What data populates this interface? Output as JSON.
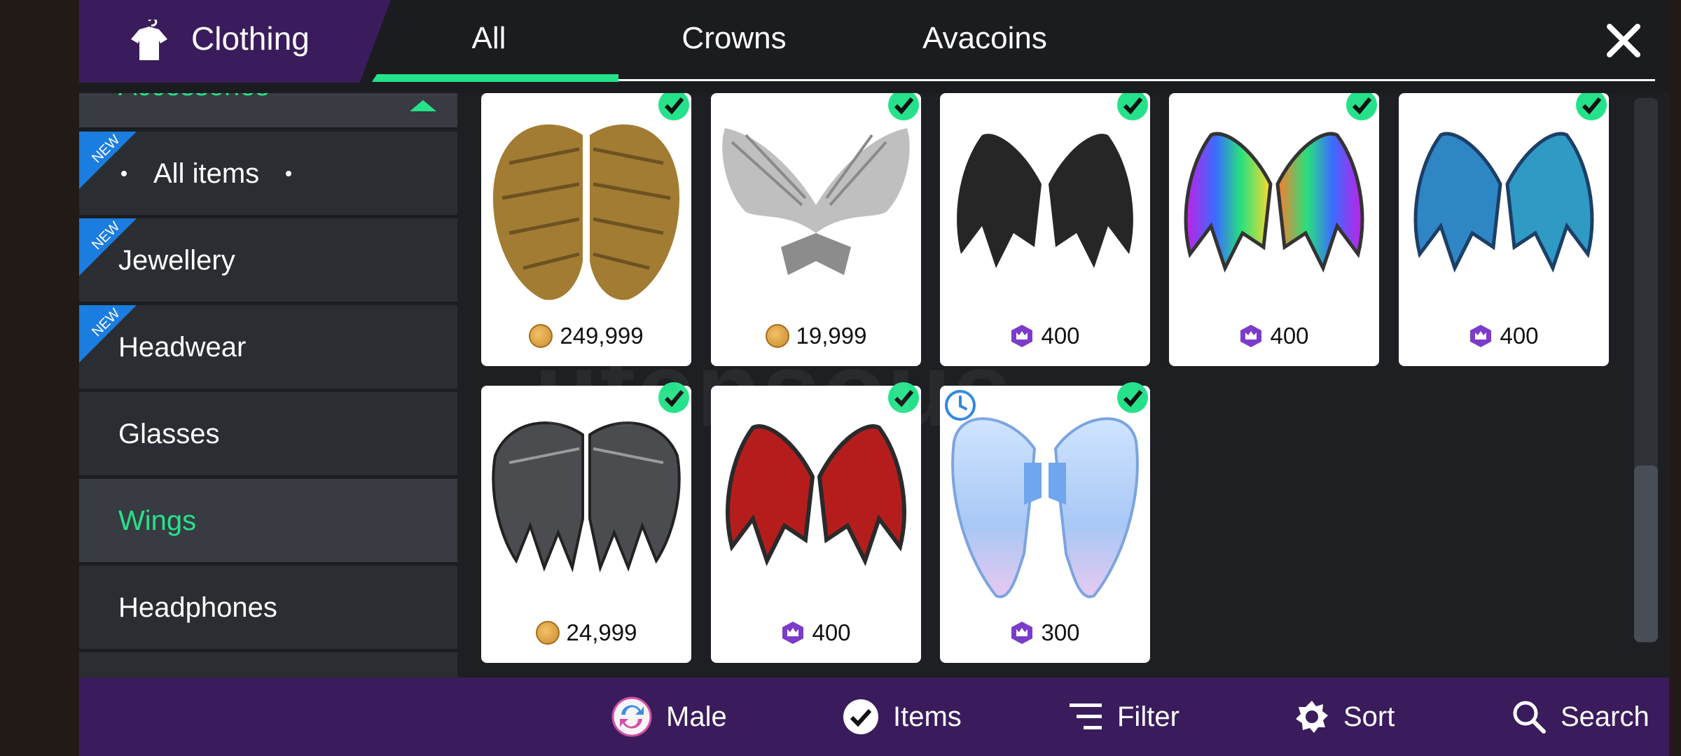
{
  "header": {
    "title": "Clothing",
    "tabs": [
      {
        "label": "All",
        "active": true
      },
      {
        "label": "Crowns",
        "active": false
      },
      {
        "label": "Avacoins",
        "active": false
      }
    ]
  },
  "sidebar": {
    "items": [
      {
        "label": "Accessories",
        "selected": true,
        "new": false
      },
      {
        "label": "All items",
        "new": true
      },
      {
        "label": "Jewellery",
        "new": true
      },
      {
        "label": "Headwear",
        "new": true
      },
      {
        "label": "Glasses",
        "new": false
      },
      {
        "label": "Wings",
        "selected": true,
        "new": false
      },
      {
        "label": "Headphones",
        "new": false
      }
    ],
    "new_badge": "NEW"
  },
  "items": [
    {
      "name": "golden-feather-wings",
      "price": "249,999",
      "currency": "avacoins",
      "owned": true
    },
    {
      "name": "silver-mechanical-wings",
      "price": "19,999",
      "currency": "avacoins",
      "owned": true
    },
    {
      "name": "black-bat-wings",
      "price": "400",
      "currency": "crowns",
      "owned": true
    },
    {
      "name": "rainbow-bat-wings",
      "price": "400",
      "currency": "crowns",
      "owned": true
    },
    {
      "name": "blue-bat-wings",
      "price": "400",
      "currency": "crowns",
      "owned": true
    },
    {
      "name": "black-leather-wings",
      "price": "24,999",
      "currency": "avacoins",
      "owned": true
    },
    {
      "name": "red-bat-wings",
      "price": "400",
      "currency": "crowns",
      "owned": true
    },
    {
      "name": "pastel-angel-wings",
      "price": "300",
      "currency": "crowns",
      "owned": true,
      "limited_time": true
    }
  ],
  "bottom_bar": {
    "male": "Male",
    "items": "Items",
    "filter": "Filter",
    "sort": "Sort",
    "search": "Search"
  },
  "watermark": "utensous",
  "colors": {
    "accent_green": "#25e28a",
    "header_purple": "#3a1c5c",
    "crown_purple": "#7b3cc9",
    "coin_gold": "#d59a3a"
  }
}
